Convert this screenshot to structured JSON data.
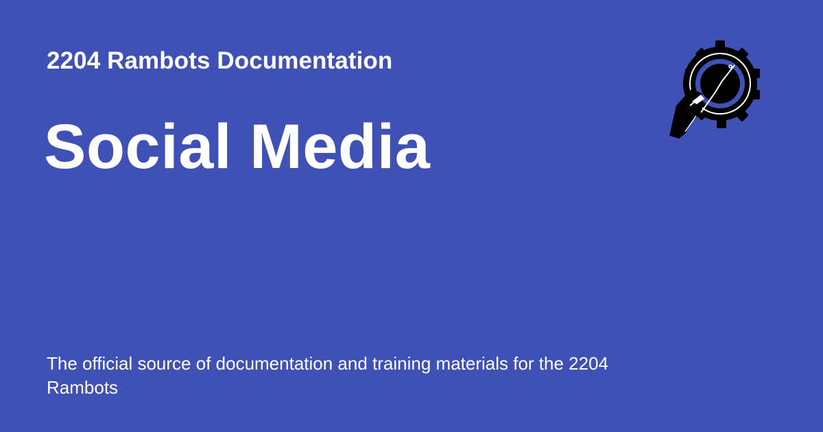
{
  "site": {
    "name": "2204 Rambots Documentation"
  },
  "page": {
    "title": "Social Media",
    "description": "The official source of documentation and training materials for the 2204 Rambots"
  },
  "colors": {
    "background": "#3f51b5",
    "text": "#ffffff",
    "logo_primary": "#000000",
    "logo_accent": "#3f51b5"
  },
  "logo": {
    "icon": "gear-wrench-logo-icon"
  }
}
